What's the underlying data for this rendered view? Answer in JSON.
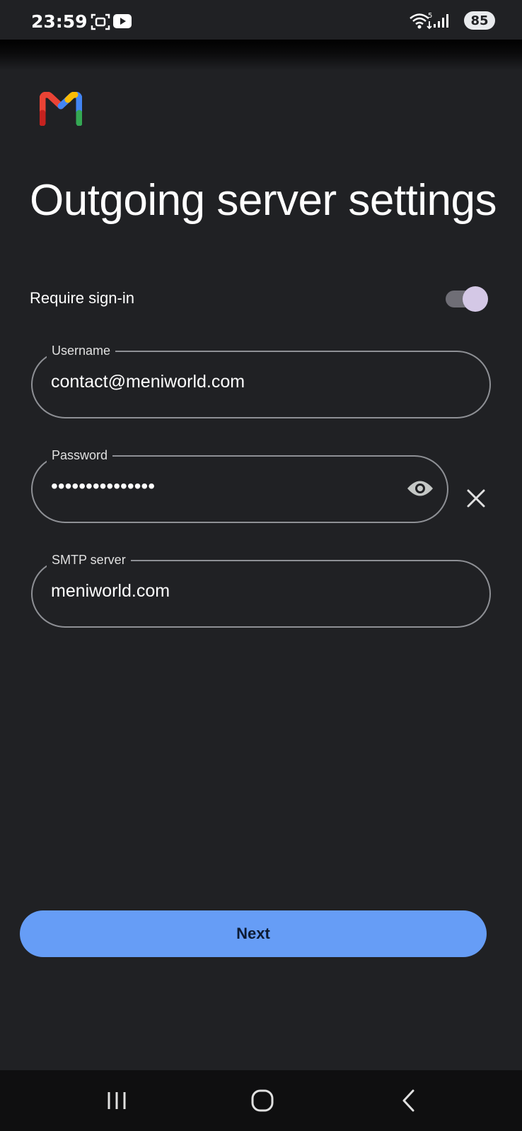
{
  "status_bar": {
    "time": "23:59",
    "battery": "85",
    "icons": [
      "screenshot-icon",
      "youtube-icon",
      "wifi-icon",
      "signal-icon",
      "battery-icon"
    ]
  },
  "app": {
    "logo": "gmail-logo",
    "title": "Outgoing server settings"
  },
  "require_signin": {
    "label": "Require sign-in",
    "enabled": true
  },
  "fields": {
    "username": {
      "label": "Username",
      "value": "contact@meniworld.com"
    },
    "password": {
      "label": "Password",
      "value": "•••••••••••••••"
    },
    "smtp_server": {
      "label": "SMTP server",
      "value": "meniworld.com"
    }
  },
  "actions": {
    "next_label": "Next"
  },
  "nav_bar": {
    "icons": [
      "recents-icon",
      "home-icon",
      "back-icon"
    ]
  },
  "colors": {
    "background": "#202124",
    "accent": "#669df6",
    "toggle_knob": "#d4c8e6",
    "outline": "#8e9095"
  }
}
